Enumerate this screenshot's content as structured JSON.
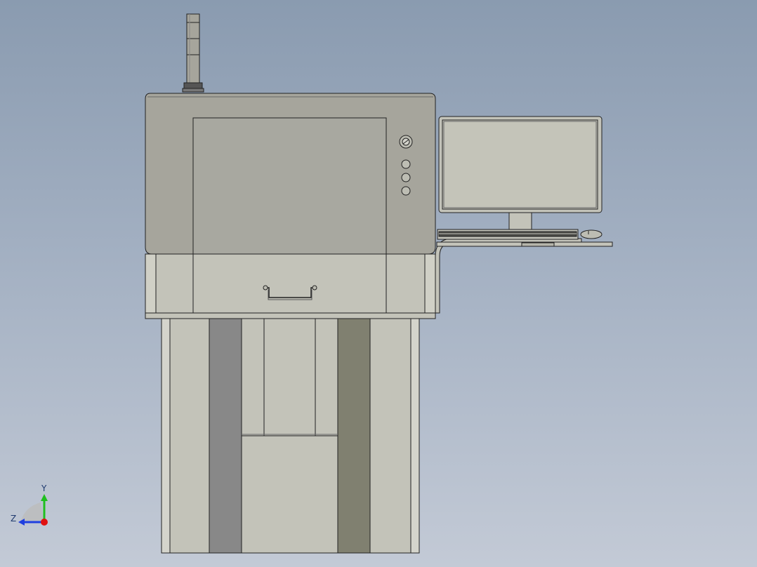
{
  "window": {
    "title": ""
  },
  "model": {
    "name": "",
    "parts": [
      "signal-tower",
      "upper-cabinet",
      "front-window",
      "control-buttons",
      "lower-drawer",
      "drawer-handle",
      "base-frame",
      "monitor",
      "keyboard",
      "mouse",
      "side-shelf"
    ],
    "colors": {
      "background_top": "#8a9bb0",
      "background_bottom": "#c3cad6",
      "cabinet": "#a6a59c",
      "cabinet_light": "#c3c3b9",
      "dark_panel_left": "#888888",
      "dark_panel_right": "#808070",
      "outline": "#222222",
      "monitor_screen": "#c4c4b9"
    }
  },
  "triad": {
    "x_label": "",
    "y_label": "Y",
    "z_label": "Z",
    "colors": {
      "y": "#1fbf1f",
      "z": "#1f3fdf",
      "origin": "#e01010"
    }
  }
}
